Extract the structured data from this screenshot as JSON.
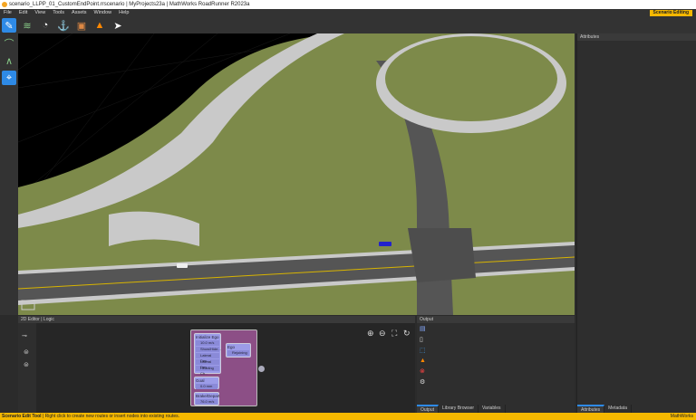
{
  "window": {
    "title": "scenario_LLPP_01_CustomEndPoint.rrscenario | MyProjects23a | MathWorks RoadRunner R2023a"
  },
  "menu": [
    "File",
    "Edit",
    "View",
    "Tools",
    "Assets",
    "Window",
    "Help"
  ],
  "mode_badge": "Scenario Editing",
  "toolbar": {
    "icons": [
      "scenario-edit-icon",
      "layers-icon",
      "world-settings-icon",
      "anchor-icon",
      "vehicle-asset-icon",
      "cone-icon",
      "pointer-icon"
    ]
  },
  "left_toolbar": {
    "icons": [
      "route-icon",
      "path-icon",
      "waypoint-icon"
    ]
  },
  "attributes_panel": {
    "title": "Attributes",
    "tabs": [
      "Attributes",
      "Metadata"
    ]
  },
  "editor": {
    "title": "2D Editor | Logic",
    "initialize": {
      "title": "Initialize Ego",
      "rows": [
        "10.0 m/s",
        "Show/Hide...",
        "Lateral Dev...",
        "Lateral Dev...",
        "Heading Ch..."
      ]
    },
    "ego": {
      "title": "Ego",
      "rows": [
        "Rejoining"
      ]
    },
    "goal": {
      "title": "Goal",
      "rows": [
        "0.0 mm"
      ]
    },
    "brake": {
      "title": "Brake/Depart",
      "rows": [
        "76.0 m/s"
      ]
    }
  },
  "output_panel": {
    "title": "Output",
    "tabs": [
      "Output",
      "Library Browser",
      "Variables"
    ]
  },
  "status": {
    "tool": "Scenario Edit Tool",
    "message": " | Right click to create new routes or insert nodes into existing routes.",
    "brand": "MathWorks"
  },
  "colors": {
    "accent": "#f5b800",
    "grass": "#7d8a4a",
    "road": "#5a5a5a",
    "selection": "#2e8ae6"
  }
}
